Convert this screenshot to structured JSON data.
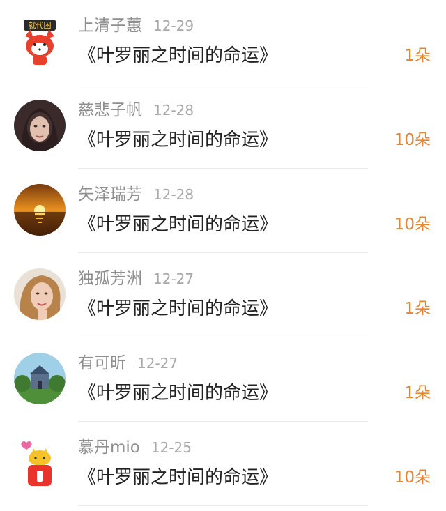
{
  "gifts": [
    {
      "name": "上清子蕙",
      "date": "12-29",
      "title": "《叶罗丽之时间的命运》",
      "count": "1朵",
      "avatar": "fox-cartoon-avatar",
      "badge": "就代困"
    },
    {
      "name": "慈悲子帆",
      "date": "12-28",
      "title": "《叶罗丽之时间的命运》",
      "count": "10朵",
      "avatar": "girl-photo-avatar"
    },
    {
      "name": "矢泽瑞芳",
      "date": "12-28",
      "title": "《叶罗丽之时间的命运》",
      "count": "10朵",
      "avatar": "sunset-avatar"
    },
    {
      "name": "独孤芳洲",
      "date": "12-27",
      "title": "《叶罗丽之时间的命运》",
      "count": "1朵",
      "avatar": "girl-portrait-avatar"
    },
    {
      "name": "有可昕",
      "date": "12-27",
      "title": "《叶罗丽之时间的命运》",
      "count": "1朵",
      "avatar": "house-landscape-avatar"
    },
    {
      "name": "慕丹mio",
      "date": "12-25",
      "title": "《叶罗丽之时间的命运》",
      "count": "10朵",
      "avatar": "yellow-cat-cartoon-avatar"
    }
  ],
  "colors": {
    "name": "#8f8f8f",
    "date": "#a8a8a8",
    "title": "#222222",
    "count": "#e8832f"
  }
}
